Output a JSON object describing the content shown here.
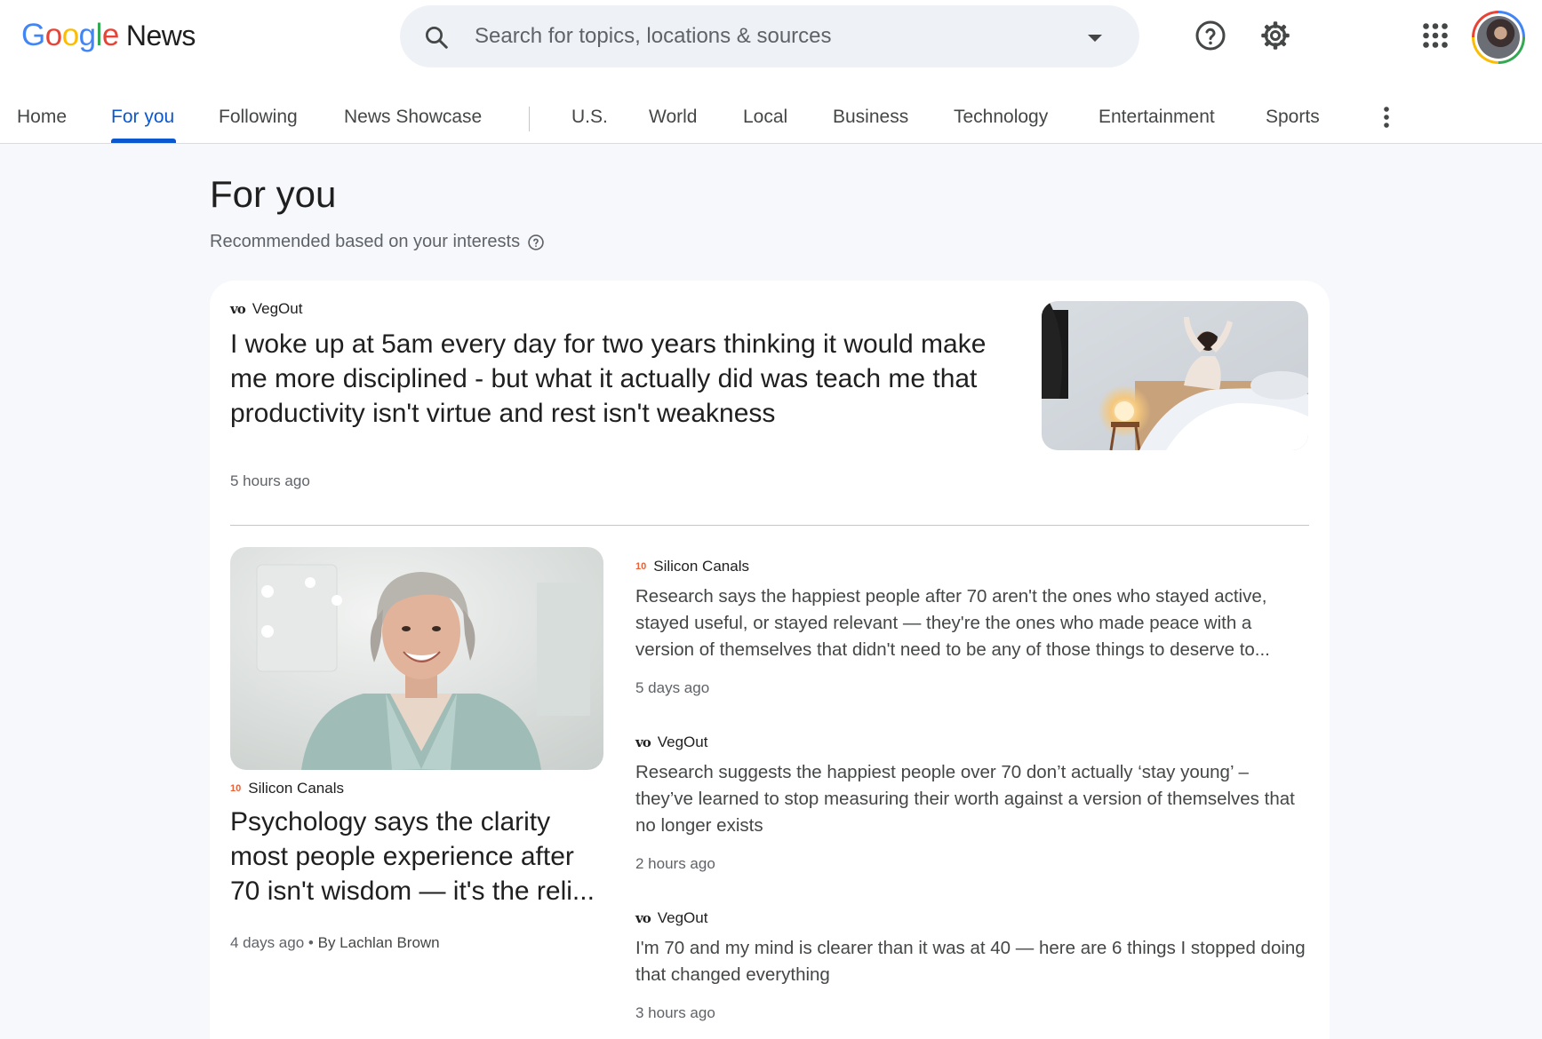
{
  "header": {
    "logo_google": [
      "G",
      "o",
      "o",
      "g",
      "l",
      "e"
    ],
    "logo_colors": [
      "#4285f4",
      "#ea4335",
      "#fbbc05",
      "#4285f4",
      "#34a853",
      "#ea4335"
    ],
    "logo_news": "News",
    "search_placeholder": "Search for topics, locations & sources",
    "icons": [
      "search-icon",
      "dropdown-caret-icon",
      "help-icon",
      "settings-icon",
      "apps-grid-icon",
      "account-avatar"
    ]
  },
  "nav": {
    "tabs": [
      {
        "label": "Home"
      },
      {
        "label": "For you",
        "active": true
      },
      {
        "label": "Following"
      },
      {
        "label": "News Showcase"
      },
      {
        "label": "U.S."
      },
      {
        "label": "World"
      },
      {
        "label": "Local"
      },
      {
        "label": "Business"
      },
      {
        "label": "Technology"
      },
      {
        "label": "Entertainment"
      },
      {
        "label": "Sports"
      }
    ],
    "accent": "#0b57d0"
  },
  "page": {
    "title": "For you",
    "subtitle": "Recommended based on your interests"
  },
  "card": {
    "top_story": {
      "source_logo": "vo",
      "source": "VegOut",
      "headline": "I woke up at 5am every day for two years thinking it would make me more disciplined - but what it actually did was teach me that productivity isn't virtue and rest isn't weakness",
      "time": "5 hours ago",
      "image": "woman-stretching-in-bed"
    },
    "feature_story": {
      "source_logo": "10",
      "source": "Silicon Canals",
      "headline": "Psychology says the clarity most people experience after 70 isn't wisdom — it's the reli...",
      "time": "4 days ago",
      "separator": "•",
      "byline": "By Lachlan Brown",
      "image": "smiling-older-woman"
    },
    "side_stories": [
      {
        "source_logo": "10",
        "source": "Silicon Canals",
        "snippet": "Research says the happiest people after 70 aren't the ones who stayed active, stayed useful, or stayed relevant — they're the ones who made peace with a version of themselves that didn't need to be any of those things to deserve to...",
        "time": "5 days ago"
      },
      {
        "source_logo": "vo",
        "source": "VegOut",
        "snippet": "Research suggests the happiest people over 70 don’t actually ‘stay young’ – they’ve learned to stop measuring their worth against a version of themselves that no longer exists",
        "time": "2 hours ago"
      },
      {
        "source_logo": "vo",
        "source": "VegOut",
        "snippet": "I'm 70 and my mind is clearer than it was at 40 — here are 6 things I stopped doing that changed everything",
        "time": "3 hours ago"
      }
    ]
  }
}
